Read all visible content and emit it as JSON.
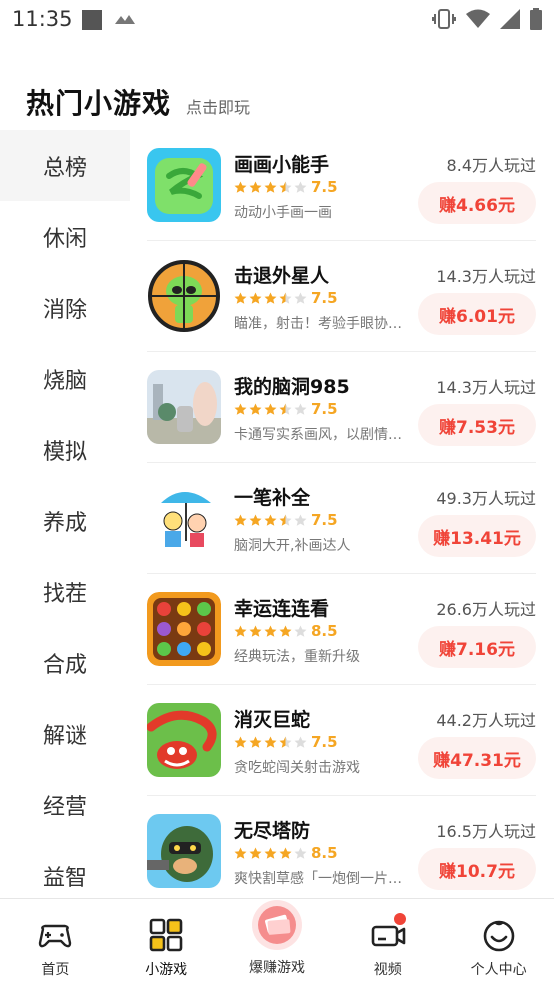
{
  "status_bar": {
    "time": "11:35"
  },
  "header": {
    "title": "热门小游戏",
    "subtitle": "点击即玩"
  },
  "categories": [
    "总榜",
    "休闲",
    "消除",
    "烧脑",
    "模拟",
    "养成",
    "找茬",
    "合成",
    "解谜",
    "经营",
    "益智"
  ],
  "games": [
    {
      "name": "画画小能手",
      "score": "7.5",
      "stars": 3.5,
      "desc": "动动小手画一画",
      "plays": "8.4万人玩过",
      "earn": "赚4.66元"
    },
    {
      "name": "击退外星人",
      "score": "7.5",
      "stars": 3.5,
      "desc": "瞄准，射击！考验手眼协…",
      "plays": "14.3万人玩过",
      "earn": "赚6.01元"
    },
    {
      "name": "我的脑洞985",
      "score": "7.5",
      "stars": 3.5,
      "desc": "卡通写实系画风，以剧情…",
      "plays": "14.3万人玩过",
      "earn": "赚7.53元"
    },
    {
      "name": "一笔补全",
      "score": "7.5",
      "stars": 3.5,
      "desc": "脑洞大开,补画达人",
      "plays": "49.3万人玩过",
      "earn": "赚13.41元"
    },
    {
      "name": "幸运连连看",
      "score": "8.5",
      "stars": 4,
      "desc": "经典玩法，重新升级",
      "plays": "26.6万人玩过",
      "earn": "赚7.16元"
    },
    {
      "name": "消灭巨蛇",
      "score": "7.5",
      "stars": 3.5,
      "desc": "贪吃蛇闯关射击游戏",
      "plays": "44.2万人玩过",
      "earn": "赚47.31元"
    },
    {
      "name": "无尽塔防",
      "score": "8.5",
      "stars": 4,
      "desc": "爽快割草感「一炮倒一片…",
      "plays": "16.5万人玩过",
      "earn": "赚10.7元"
    }
  ],
  "nav": {
    "home": "首页",
    "minigames": "小游戏",
    "hot": "爆赚游戏",
    "video": "视频",
    "profile": "个人中心"
  },
  "colors": {
    "accent": "#f04438",
    "star": "#f5a623",
    "earn_bg": "#fdf1ef"
  }
}
